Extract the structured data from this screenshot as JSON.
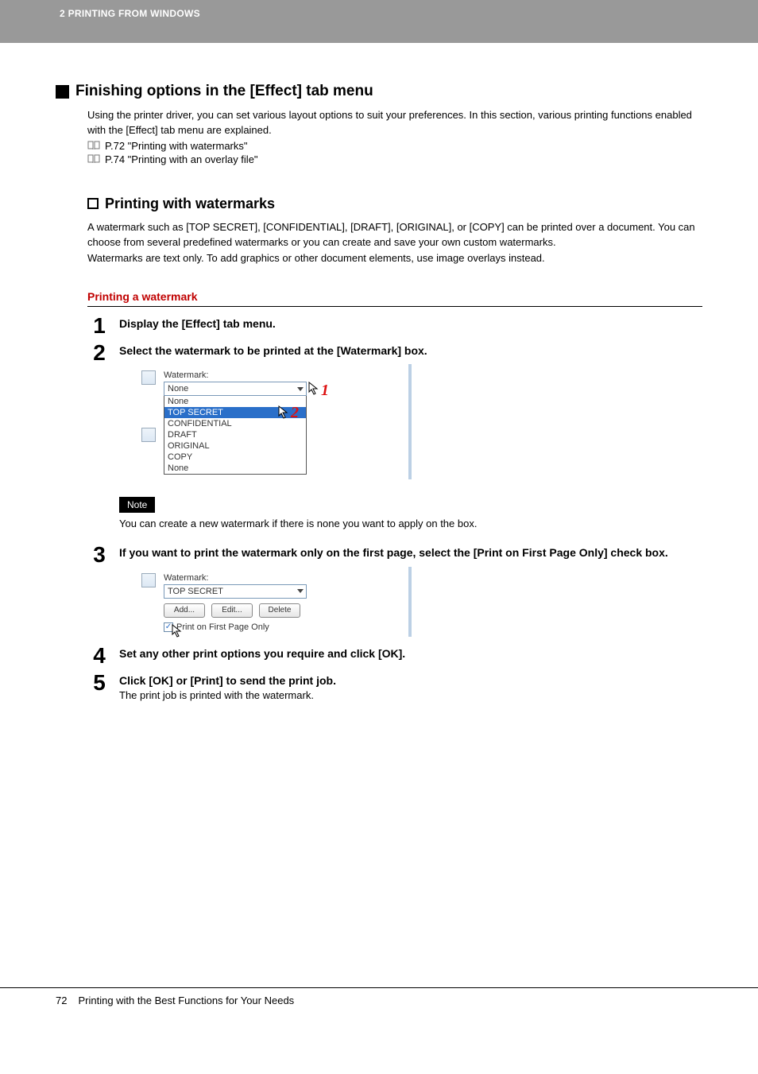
{
  "header": {
    "chapter": "2 PRINTING FROM WINDOWS"
  },
  "h1": "Finishing options in the [Effect] tab menu",
  "intro": "Using the printer driver, you can set various layout options to suit your preferences. In this section, various printing functions enabled with the [Effect] tab menu are explained.",
  "refs": {
    "r1": "P.72 \"Printing with watermarks\"",
    "r2": "P.74 \"Printing with an overlay file\""
  },
  "h2": "Printing with watermarks",
  "para1": "A watermark such as [TOP SECRET], [CONFIDENTIAL], [DRAFT], [ORIGINAL], or [COPY] can be printed over a document. You can choose from several predefined watermarks or you can create and save your own custom watermarks.",
  "para2": "Watermarks are text only. To add graphics or other document elements, use image overlays instead.",
  "h3": "Printing a watermark",
  "steps": {
    "s1": {
      "num": "1",
      "title": "Display the [Effect] tab menu."
    },
    "s2": {
      "num": "2",
      "title": "Select the watermark to be printed at the [Watermark] box."
    },
    "s3": {
      "num": "3",
      "title": "If you want to print the watermark only on the first page, select the [Print on First Page Only] check box."
    },
    "s4": {
      "num": "4",
      "title": "Set any other print options you require and click [OK]."
    },
    "s5": {
      "num": "5",
      "title": "Click [OK] or [Print] to send the print job.",
      "sub": "The print job is printed with the watermark."
    }
  },
  "note": {
    "label": "Note",
    "text": "You can create a new watermark if there is none you want to apply on the box."
  },
  "shot1": {
    "label": "Watermark:",
    "selected": "None",
    "options": {
      "o0": "None",
      "o1": "TOP SECRET",
      "o2": "CONFIDENTIAL",
      "o3": "DRAFT",
      "o4": "ORIGINAL",
      "o5": "COPY",
      "o6": "None"
    },
    "callout1": "1",
    "callout2": "2"
  },
  "shot2": {
    "label": "Watermark:",
    "selected": "TOP SECRET",
    "btn_add": "Add...",
    "btn_edit": "Edit...",
    "btn_delete": "Delete",
    "checkbox": "Print on First Page Only"
  },
  "footer": {
    "page": "72",
    "title": "Printing with the Best Functions for Your Needs"
  }
}
